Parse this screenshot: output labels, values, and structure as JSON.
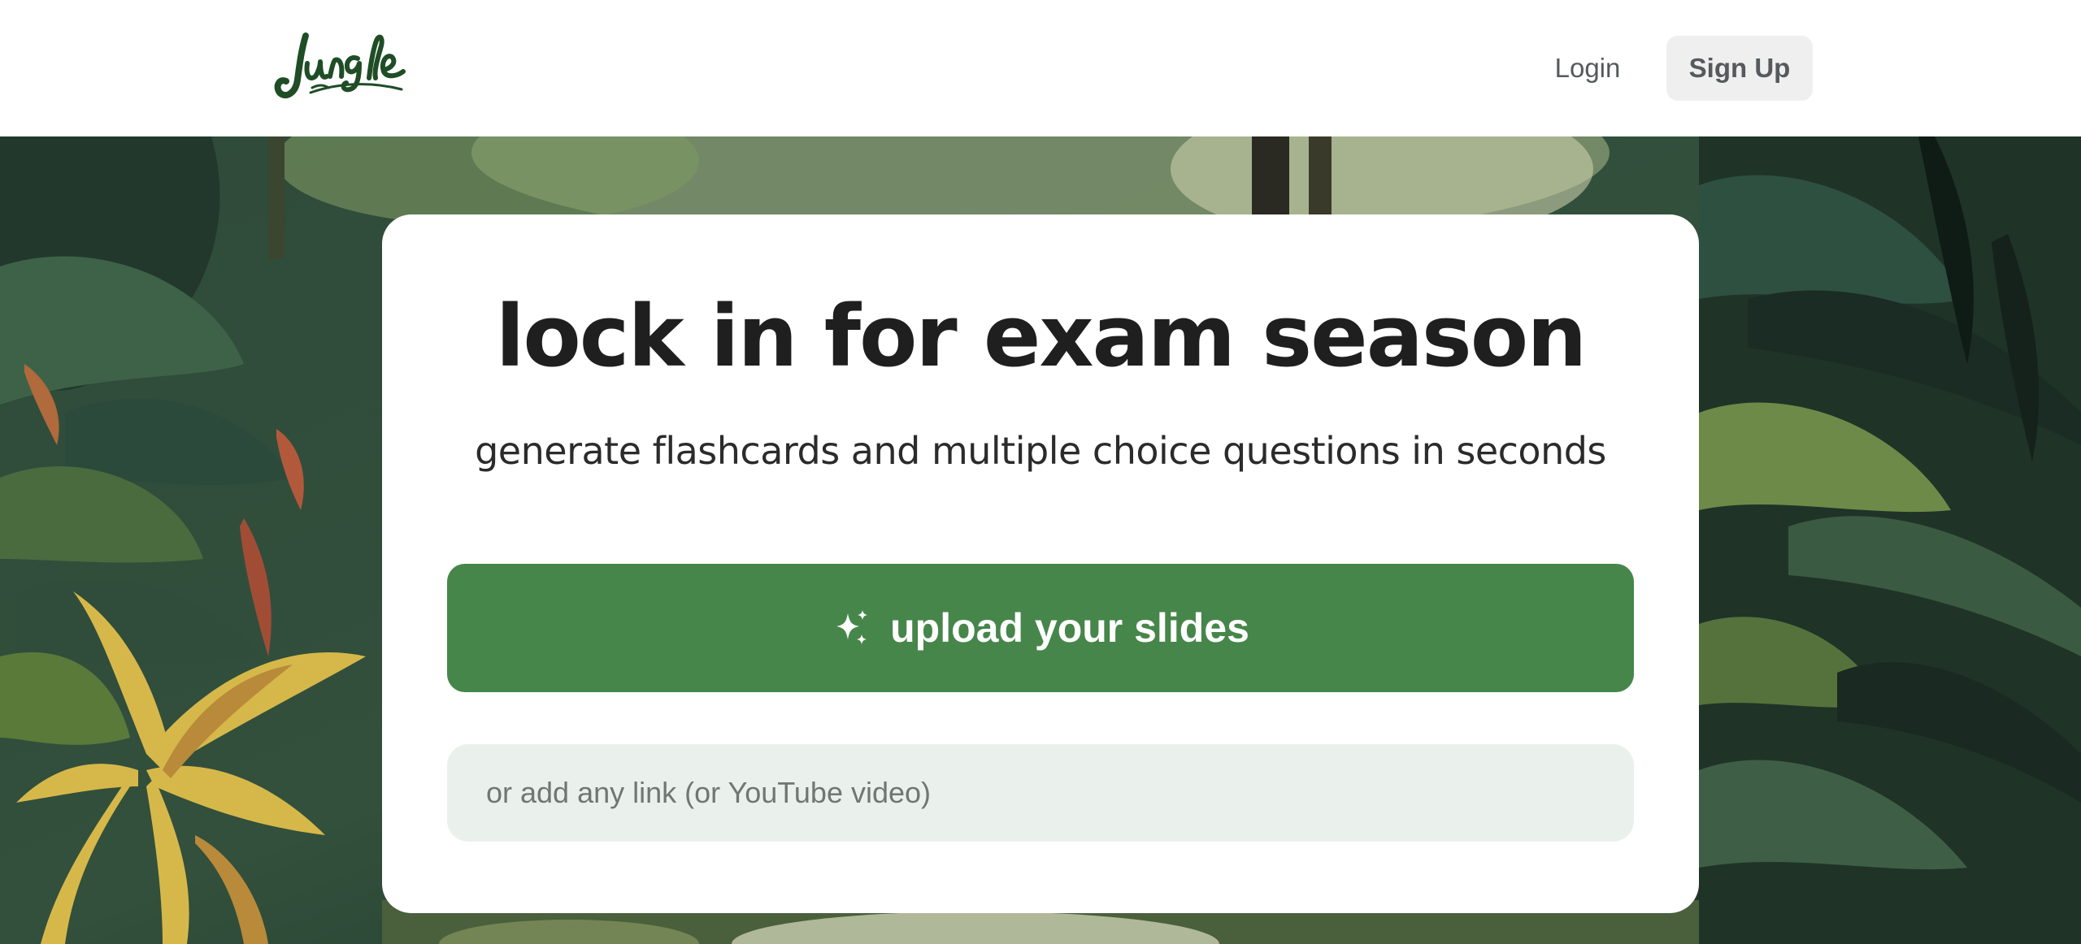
{
  "header": {
    "logo_text": "Jungle",
    "login_label": "Login",
    "signup_label": "Sign Up"
  },
  "hero": {
    "headline": "lock in for exam season",
    "subheadline": "generate flashcards and multiple choice questions in seconds",
    "upload_label": "upload your slides",
    "upload_icon": "sparkles-icon",
    "link_placeholder": "or add any link (or YouTube video)"
  },
  "colors": {
    "brand_green": "#46864a",
    "logo_green": "#1f4d26",
    "input_background": "#eaf1ed"
  }
}
